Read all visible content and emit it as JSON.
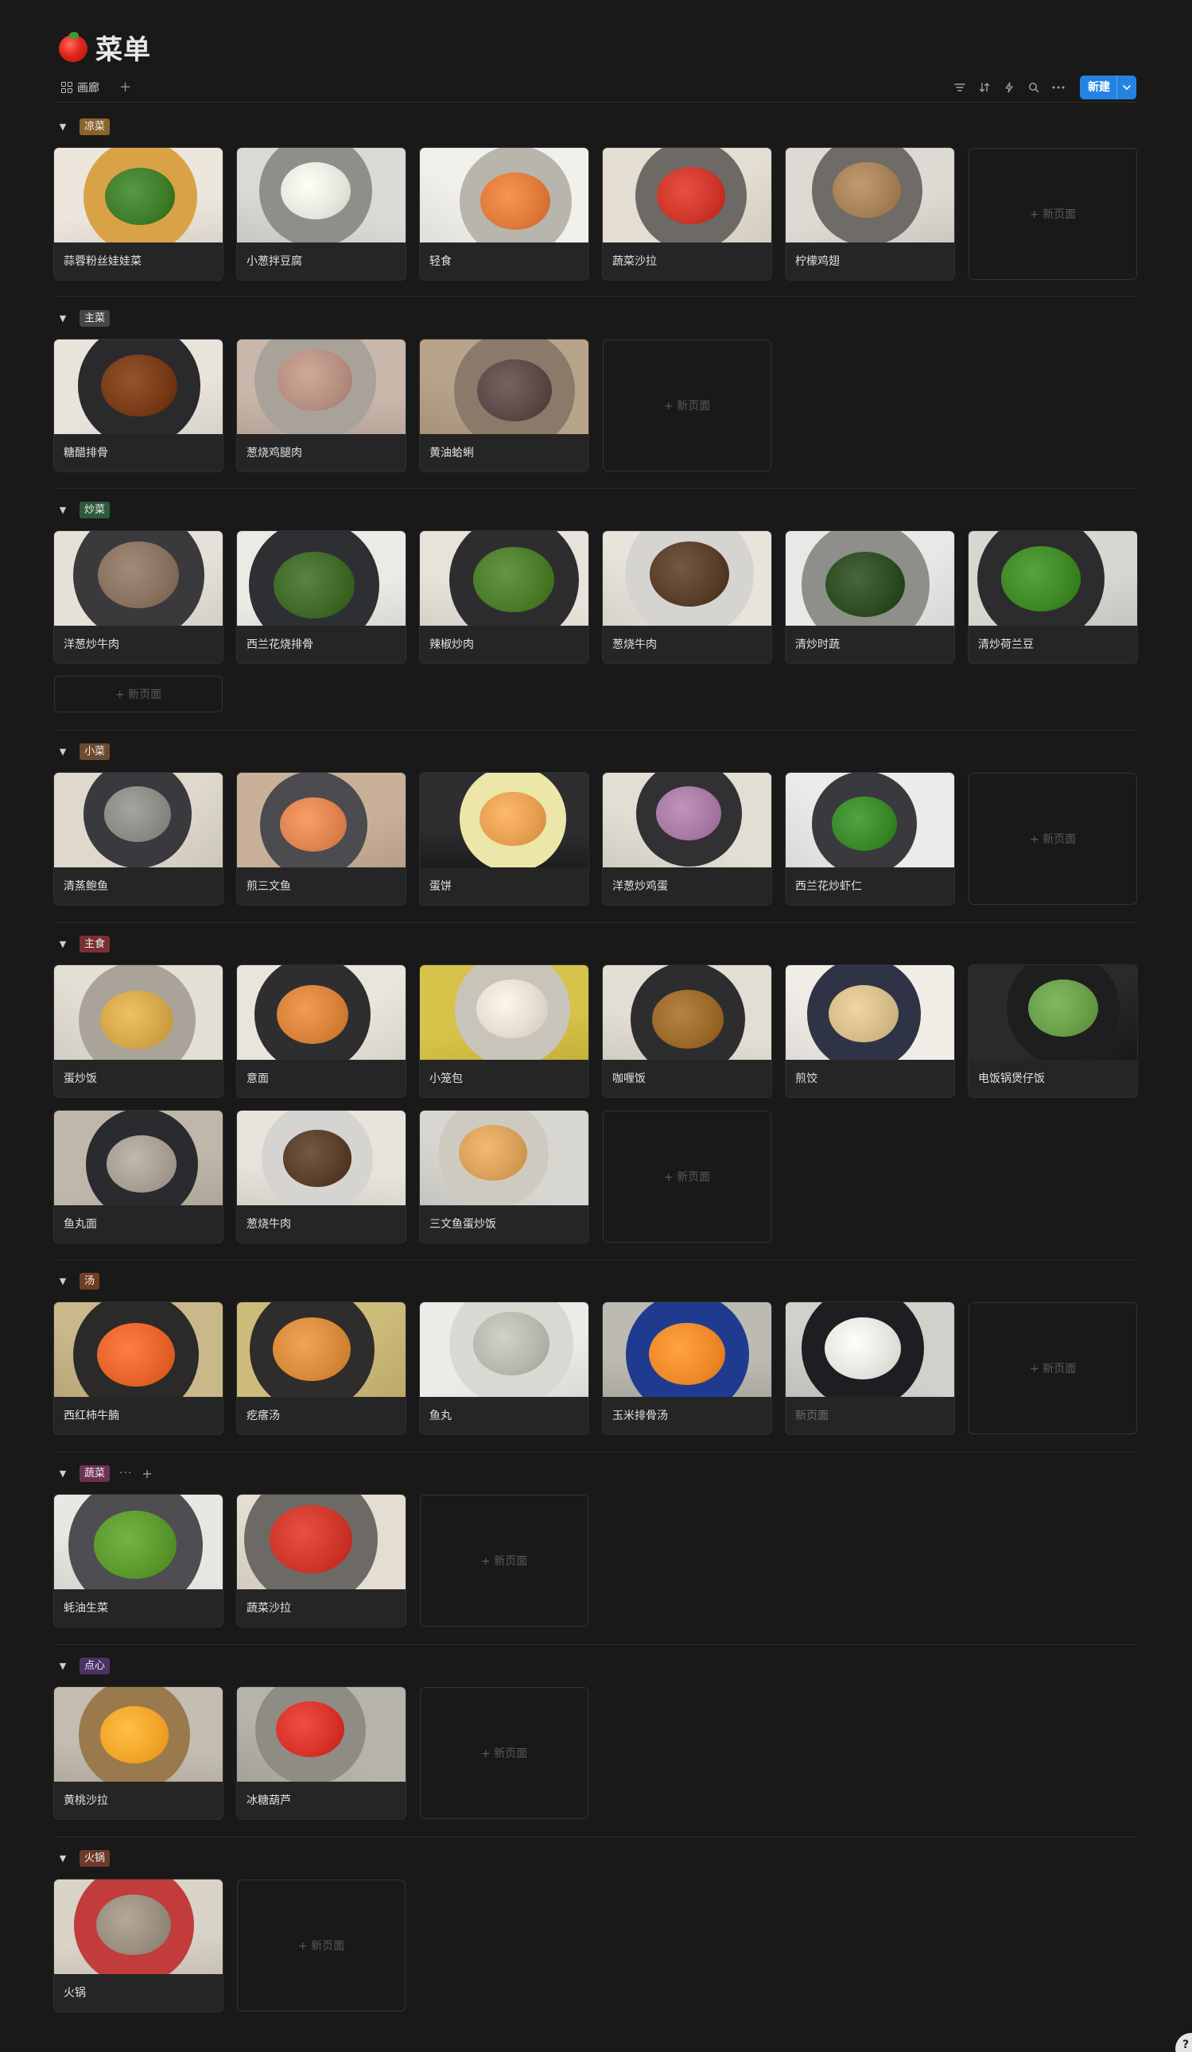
{
  "page": {
    "title": "菜单",
    "view_tab": "画廊",
    "add_view": "+",
    "new_button": "新建",
    "help": "?"
  },
  "toolbar_icons": [
    "filter-icon",
    "sort-icon",
    "automation-bolt-icon",
    "search-icon",
    "more-icon"
  ],
  "new_page_label": "+  新页面",
  "colors": {
    "background": "#191919",
    "card": "#252525",
    "accent": "#2383e2"
  },
  "groups": [
    {
      "name": "凉菜",
      "tag_color": "#89632a",
      "cards": [
        {
          "title": "蒜蓉粉丝娃娃菜",
          "img": [
            "#ece6dc",
            "#d9a247",
            "#3f7e2a"
          ]
        },
        {
          "title": "小葱拌豆腐",
          "img": [
            "#d9d9d5",
            "#8d8f88",
            "#e7e8df"
          ]
        },
        {
          "title": "轻食",
          "img": [
            "#f2f0ea",
            "#b8b5ac",
            "#e07b3b"
          ]
        },
        {
          "title": "蔬菜沙拉",
          "img": [
            "#e3ddd2",
            "#6d6a66",
            "#d0372b"
          ]
        },
        {
          "title": "柠檬鸡翅",
          "img": [
            "#dcdad2",
            "#6f6b66",
            "#a88257"
          ]
        }
      ]
    },
    {
      "name": "主菜",
      "tag_color": "#454545",
      "cards": [
        {
          "title": "糖醋排骨",
          "img": [
            "#e8e4dc",
            "#2a2a2d",
            "#7a3b17"
          ]
        },
        {
          "title": "葱烧鸡腿肉",
          "img": [
            "#c9b7ab",
            "#a9a29a",
            "#b79082"
          ]
        },
        {
          "title": "黄油蛤蜊",
          "img": [
            "#b8a48b",
            "#8a7a69",
            "#5b4a48"
          ]
        }
      ]
    },
    {
      "name": "炒菜",
      "tag_color": "#2d5a3b",
      "cards": [
        {
          "title": "洋葱炒牛肉",
          "img": [
            "#e6e1d8",
            "#3a3a3c",
            "#8a7260"
          ]
        },
        {
          "title": "西兰花烧排骨",
          "img": [
            "#eceae4",
            "#2e2f33",
            "#3f6a27"
          ]
        },
        {
          "title": "辣椒炒肉",
          "img": [
            "#e7e3da",
            "#2d2d30",
            "#4b7d2a"
          ]
        },
        {
          "title": "葱烧牛肉",
          "img": [
            "#e8e4dc",
            "#d6d4d0",
            "#5a3f2a"
          ]
        },
        {
          "title": "清炒时蔬",
          "img": [
            "#e8e8e6",
            "#8e8f8b",
            "#2e4d22"
          ]
        },
        {
          "title": "清炒荷兰豆",
          "img": [
            "#d8d6d0",
            "#2c2c2e",
            "#3f8a26"
          ]
        }
      ]
    },
    {
      "name": "小菜",
      "tag_color": "#6b4a2e",
      "cards": [
        {
          "title": "清蒸鲍鱼",
          "img": [
            "#ded8cd",
            "#3a3a3e",
            "#8c8c86"
          ]
        },
        {
          "title": "煎三文鱼",
          "img": [
            "#c9b199",
            "#4b4b50",
            "#e08450"
          ]
        },
        {
          "title": "蛋饼",
          "img": [
            "#2e2e30",
            "#ece6a9",
            "#e7a052"
          ]
        },
        {
          "title": "洋葱炒鸡蛋",
          "img": [
            "#e2ded4",
            "#313134",
            "#a97aa3"
          ]
        },
        {
          "title": "西兰花炒虾仁",
          "img": [
            "#ebebe9",
            "#3a3a3e",
            "#3a8a2c"
          ]
        }
      ]
    },
    {
      "name": "主食",
      "tag_color": "#7a3030",
      "cards": [
        {
          "title": "蛋炒饭",
          "img": [
            "#e4dfd5",
            "#a9a39a",
            "#d4a84a"
          ]
        },
        {
          "title": "意面",
          "img": [
            "#e9e5dc",
            "#2e2e31",
            "#d8823a"
          ]
        },
        {
          "title": "小笼包",
          "img": [
            "#d7c24a",
            "#c9c4ba",
            "#e7ddd2"
          ]
        },
        {
          "title": "咖喱饭",
          "img": [
            "#e3ded3",
            "#2d2d30",
            "#9c6a2a"
          ]
        },
        {
          "title": "煎饺",
          "img": [
            "#f0ede6",
            "#2f3346",
            "#d7bd8a"
          ]
        },
        {
          "title": "电饭锅煲仔饭",
          "img": [
            "#2a2a2c",
            "#1e1e20",
            "#6aa049"
          ]
        },
        {
          "title": "鱼丸面",
          "img": [
            "#bfb7aa",
            "#2a2b2e",
            "#a89f94"
          ]
        },
        {
          "title": "葱烧牛肉",
          "img": [
            "#e8e4dc",
            "#d6d4d0",
            "#5a3f2a"
          ]
        },
        {
          "title": "三文鱼蛋炒饭",
          "img": [
            "#d8d6d0",
            "#cfcac0",
            "#d9a15a"
          ]
        }
      ]
    },
    {
      "name": "汤",
      "tag_color": "#6e3f22",
      "cards": [
        {
          "title": "西红柿牛腩",
          "img": [
            "#c9b98a",
            "#2b2a28",
            "#e8642a"
          ]
        },
        {
          "title": "疙瘩汤",
          "img": [
            "#cdbb7c",
            "#2e2d2b",
            "#d98a3a"
          ]
        },
        {
          "title": "鱼丸",
          "img": [
            "#ebebe8",
            "#d9d9d3",
            "#b8b8ae"
          ]
        },
        {
          "title": "玉米排骨汤",
          "img": [
            "#bdbab3",
            "#1f3b8f",
            "#f08a2a"
          ]
        },
        {
          "title": "新页面",
          "muted": true,
          "img": [
            "#d2d0cb",
            "#1e1e22",
            "#e4e6e0"
          ]
        }
      ]
    },
    {
      "name": "蔬菜",
      "tag_color": "#6e3050",
      "extras": true,
      "cards": [
        {
          "title": "蚝油生菜",
          "img": [
            "#e9e7e1",
            "#4e4d52",
            "#5d9a2e"
          ]
        },
        {
          "title": "蔬菜沙拉",
          "img": [
            "#e3ddd2",
            "#6d6a66",
            "#d0372b"
          ]
        }
      ]
    },
    {
      "name": "点心",
      "tag_color": "#4a3266",
      "cards": [
        {
          "title": "黄桃沙拉",
          "img": [
            "#c3bdb2",
            "#9a7a4c",
            "#f2a62a"
          ]
        },
        {
          "title": "冰糖葫芦",
          "img": [
            "#b6b3ad",
            "#8f8c86",
            "#d9342a"
          ]
        }
      ]
    },
    {
      "name": "火锅",
      "tag_color": "#6e3a28",
      "cards": [
        {
          "title": "火锅",
          "img": [
            "#d9d3c8",
            "#c13c3a",
            "#9a8f80"
          ]
        }
      ]
    }
  ]
}
